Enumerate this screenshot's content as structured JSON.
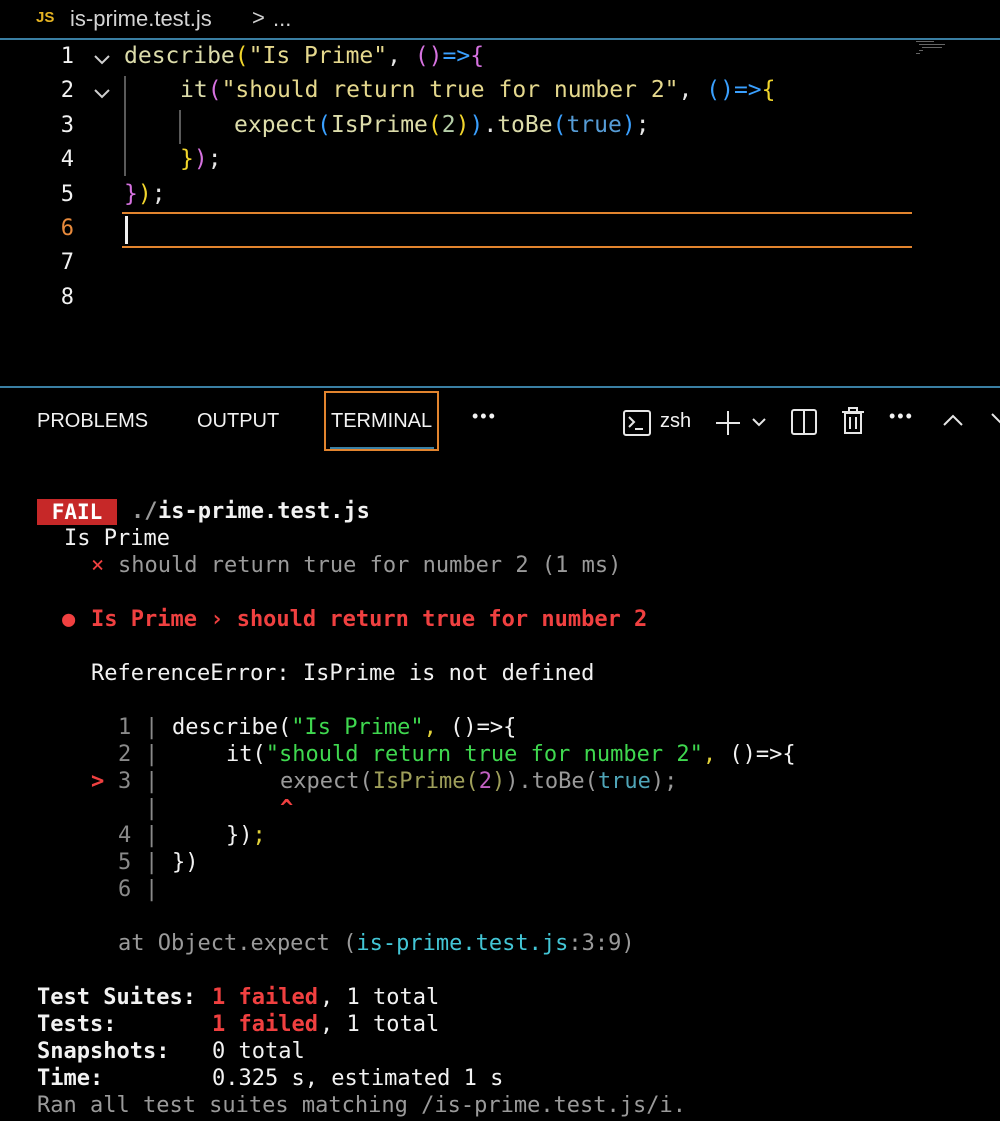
{
  "breadcrumb": {
    "lang_badge": "JS",
    "file": "is-prime.test.js",
    "separator": ">",
    "ellipsis": "..."
  },
  "editor": {
    "line_numbers": [
      "1",
      "2",
      "3",
      "4",
      "5",
      "6",
      "7",
      "8"
    ],
    "active_line": "6",
    "lines": [
      [
        {
          "t": "describe",
          "c": "c-fn"
        },
        {
          "t": "(",
          "c": "c-y"
        },
        {
          "t": "\"Is Prime\"",
          "c": "c-str"
        },
        {
          "t": ", ",
          "c": "c-w"
        },
        {
          "t": "()",
          "c": "c-p"
        },
        {
          "t": "=>",
          "c": "c-b"
        },
        {
          "t": "{",
          "c": "c-p"
        }
      ],
      [
        {
          "t": "it",
          "c": "c-fn"
        },
        {
          "t": "(",
          "c": "c-p"
        },
        {
          "t": "\"should return true for number 2\"",
          "c": "c-str"
        },
        {
          "t": ", ",
          "c": "c-w"
        },
        {
          "t": "()",
          "c": "c-b"
        },
        {
          "t": "=>",
          "c": "c-b"
        },
        {
          "t": "{",
          "c": "c-y"
        }
      ],
      [
        {
          "t": "expect",
          "c": "c-fn"
        },
        {
          "t": "(",
          "c": "c-b"
        },
        {
          "t": "IsPrime",
          "c": "c-fn"
        },
        {
          "t": "(",
          "c": "c-y"
        },
        {
          "t": "2",
          "c": "c-num"
        },
        {
          "t": ")",
          "c": "c-y"
        },
        {
          "t": ")",
          "c": "c-b"
        },
        {
          "t": ".",
          "c": "c-w"
        },
        {
          "t": "toBe",
          "c": "c-fn"
        },
        {
          "t": "(",
          "c": "c-b"
        },
        {
          "t": "true",
          "c": "c-kw"
        },
        {
          "t": ")",
          "c": "c-b"
        },
        {
          "t": ";",
          "c": "c-w"
        }
      ],
      [
        {
          "t": "}",
          "c": "c-y"
        },
        {
          "t": ")",
          "c": "c-p"
        },
        {
          "t": ";",
          "c": "c-w"
        }
      ],
      [
        {
          "t": "}",
          "c": "c-p"
        },
        {
          "t": ")",
          "c": "c-y"
        },
        {
          "t": ";",
          "c": "c-w"
        }
      ]
    ]
  },
  "panel": {
    "tabs": {
      "problems": "PROBLEMS",
      "output": "OUTPUT",
      "terminal": "TERMINAL",
      "more": "•••"
    },
    "shell": "zsh",
    "actions_more": "•••"
  },
  "terminal": {
    "fail_badge": "FAIL",
    "file_prefix": "./",
    "file_name": "is-prime.test.js",
    "suite_name": "Is Prime",
    "test_mark": "×",
    "test_result": "should return true for number 2 (1 ms)",
    "error_bullet": "●",
    "error_title": "Is Prime › should return true for number 2",
    "error_message": "ReferenceError: IsPrime is not defined",
    "snippet": {
      "nums": [
        "1",
        "2",
        "3",
        "",
        "4",
        "5",
        "6"
      ],
      "pointer": ">",
      "caret": "^",
      "pipe": "|"
    },
    "stack": {
      "prefix": "at Object.expect (",
      "file": "is-prime.test.js",
      "loc": ":3:9)"
    },
    "summary": {
      "suites_label": "Test Suites:",
      "suites_failed": "1 failed",
      "suites_total": ", 1 total",
      "tests_label": "Tests:",
      "tests_failed": "1 failed",
      "tests_total": ", 1 total",
      "snapshots_label": "Snapshots:",
      "snapshots_value": "0 total",
      "time_label": "Time:",
      "time_value": "0.325 s, estimated 1 s",
      "ran": "Ran all test suites matching /is-prime.test.js/i."
    }
  },
  "colors": {
    "accent_orange": "#e2842e",
    "fail_red": "#c62828",
    "divider_blue": "#3a7fa3"
  }
}
